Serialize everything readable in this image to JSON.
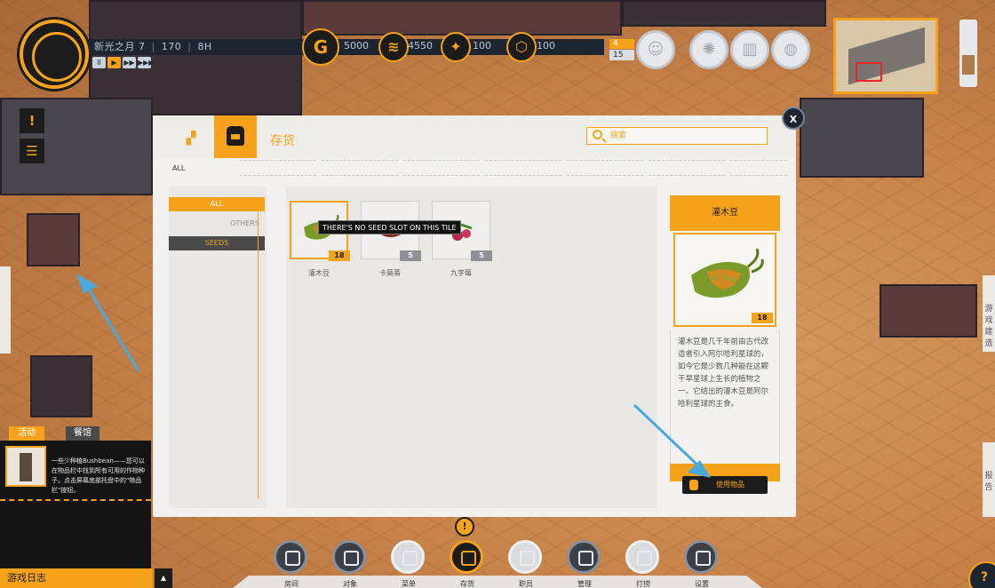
{
  "hud": {
    "date_label": "新光之月",
    "day": "7",
    "year": "170",
    "hour": "8H",
    "speed_controls": [
      "II",
      "▶",
      "▶▶",
      "▶▶▶"
    ],
    "money": "5000",
    "resource_a": "4550",
    "resource_b": "100",
    "resource_c": "100",
    "population_badge": "4",
    "capacity_badge": "15"
  },
  "inventory": {
    "title": "存货",
    "search_placeholder": "搜索",
    "close_label": "X",
    "filter_all": "ALL",
    "side_all": "ALL",
    "side_others": "OTHERS",
    "side_seeds": "SEEDS",
    "tooltip": "THERE'S NO SEED SLOT ON THIS TILE",
    "items": [
      {
        "name": "灌木豆",
        "count": "18"
      },
      {
        "name": "卡莫蒂",
        "count": "5"
      },
      {
        "name": "九字莓",
        "count": "5"
      }
    ],
    "detail": {
      "title": "灌木豆",
      "count": "18",
      "description": "灌木豆是几千年前由古代改造者引入阿尔哈利星球的，如今它是少数几种能在这颗干旱星球上生长的植物之一。它结出的灌木豆是阿尔哈利星球的主食。",
      "use_button": "使用物品"
    }
  },
  "left_panel": {
    "tab_activity": "活动",
    "tab_restaurant": "餐馆",
    "event_text": "一些少种植Bushbean——您可以在物品栏中找到所有可用的作物种子。点击屏幕底部托盘中的\"物品栏\"按钮。",
    "game_log": "游戏日志"
  },
  "edge_tabs": [
    "游戏",
    "建造",
    "报告"
  ],
  "nav": [
    {
      "label": "房间",
      "style": "dark"
    },
    {
      "label": "对象",
      "style": "dark"
    },
    {
      "label": "菜单",
      "style": "light"
    },
    {
      "label": "存货",
      "style": "active"
    },
    {
      "label": "职员",
      "style": "light"
    },
    {
      "label": "管理",
      "style": "dark"
    },
    {
      "label": "打捞",
      "style": "light"
    },
    {
      "label": "设置",
      "style": "dark"
    }
  ],
  "colors": {
    "accent": "#f7a21b",
    "hud_dark": "#1d2530",
    "panel_bg": "#f2f1ef"
  }
}
